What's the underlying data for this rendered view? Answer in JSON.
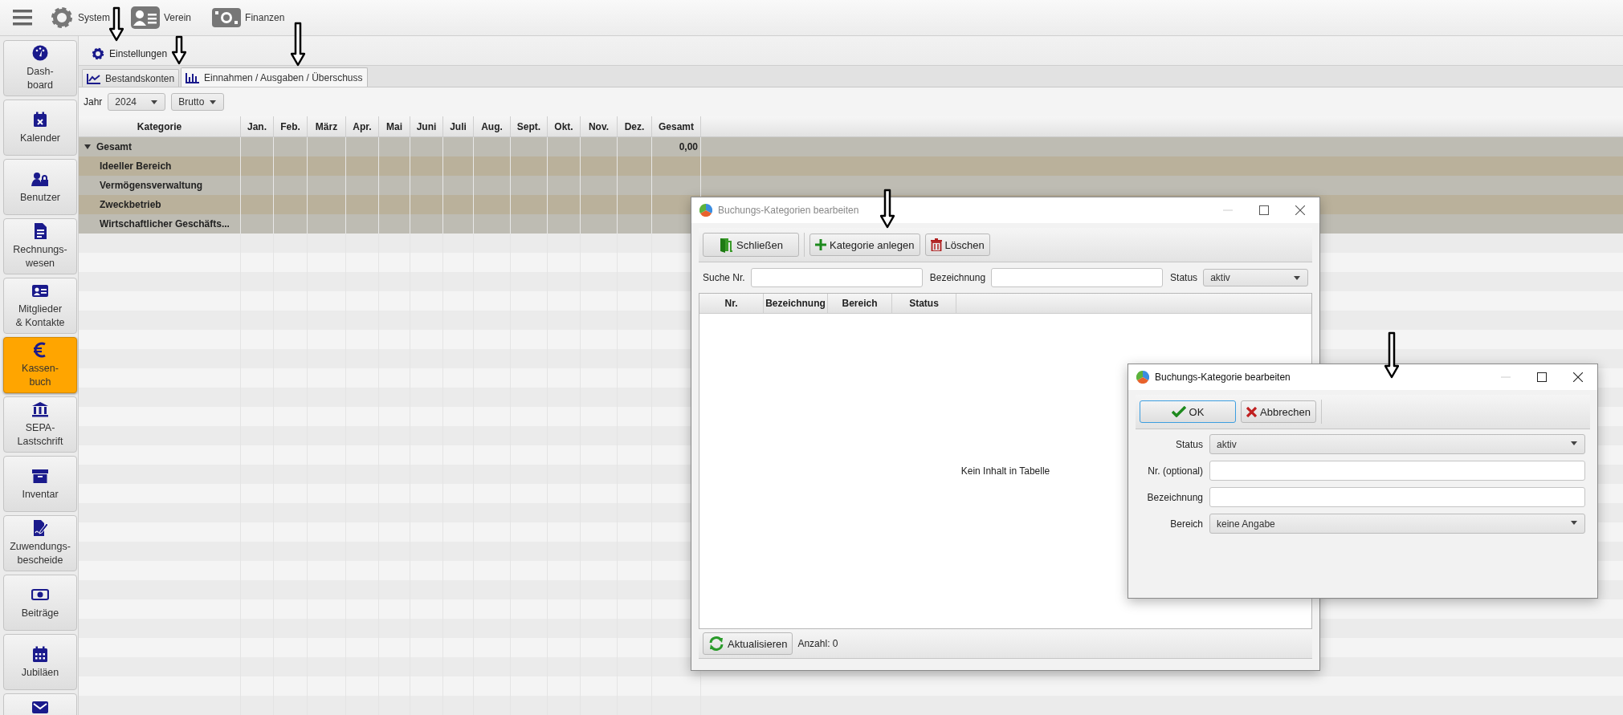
{
  "menu_bar": {
    "items": [
      {
        "label": "System"
      },
      {
        "label": "Verein"
      },
      {
        "label": "Finanzen"
      }
    ]
  },
  "sidebar": {
    "items": [
      {
        "label": "Dash-\nboard",
        "selected": false
      },
      {
        "label": "Kalender",
        "selected": false
      },
      {
        "label": "Benutzer",
        "selected": false
      },
      {
        "label": "Rechnungs-\nwesen",
        "selected": false
      },
      {
        "label": "Mitglieder\n& Kontakte",
        "selected": false
      },
      {
        "label": "Kassen-\nbuch",
        "selected": true
      },
      {
        "label": "SEPA-\nLastschrift",
        "selected": false
      },
      {
        "label": "Inventar",
        "selected": false
      },
      {
        "label": "Zuwendungs-\nbescheide",
        "selected": false
      },
      {
        "label": "Beiträge",
        "selected": false
      },
      {
        "label": "Jubiläen",
        "selected": false
      },
      {
        "selected": false
      }
    ]
  },
  "toolbar": {
    "button": "Einstellungen"
  },
  "tabs": [
    {
      "label": "Bestandskonten",
      "selected": false
    },
    {
      "label": "Einnahmen / Ausgaben / Überschuss",
      "selected": true
    }
  ],
  "filters": {
    "year_label": "Jahr",
    "year": "2024",
    "mode": "Brutto"
  },
  "table": {
    "columns": [
      "Kategorie",
      "Jan.",
      "Feb.",
      "März",
      "Apr.",
      "Mai",
      "Juni",
      "Juli",
      "Aug.",
      "Sept.",
      "Okt.",
      "Nov.",
      "Dez.",
      "Gesamt"
    ],
    "rows": [
      {
        "category": "Gesamt",
        "total": "0,00",
        "expanded": true,
        "children": [
          {
            "category": "Ideeller Bereich"
          },
          {
            "category": "Vermögensverwaltung"
          },
          {
            "category": "Zweckbetrieb"
          },
          {
            "category": "Wirtschaftlicher Geschäfts..."
          }
        ]
      }
    ]
  },
  "category_list_dialog": {
    "title": "Buchungs-Kategorien bearbeiten",
    "active": false,
    "buttons": [
      {
        "label": "Schließen",
        "kind": "close"
      },
      {
        "label": "Kategorie anlegen",
        "kind": "add"
      },
      {
        "label": "Löschen",
        "kind": "delete"
      }
    ],
    "search": {
      "number_label": "Suche Nr.",
      "name_label": "Bezeichnung",
      "status_label": "Status",
      "status": "aktiv"
    },
    "columns": [
      "Nr.",
      "Bezeichnung",
      "Bereich",
      "Status"
    ],
    "empty_text": "Kein Inhalt in Tabelle",
    "refresh_button": "Aktualisieren",
    "count": "Anzahl: 0"
  },
  "category_edit_dialog": {
    "title": "Buchungs-Kategorie bearbeiten",
    "active": true,
    "buttons": [
      {
        "label": "OK",
        "kind": "ok",
        "focused": true
      },
      {
        "label": "Abbrechen",
        "kind": "cancel",
        "focused": false
      }
    ],
    "fields": [
      {
        "label": "Status",
        "kind": "select",
        "value": "aktiv"
      },
      {
        "label": "Nr. (optional)",
        "kind": "text"
      },
      {
        "label": "Bezeichnung",
        "kind": "text"
      },
      {
        "label": "Bereich",
        "kind": "select",
        "value": "keine Angabe"
      }
    ]
  }
}
